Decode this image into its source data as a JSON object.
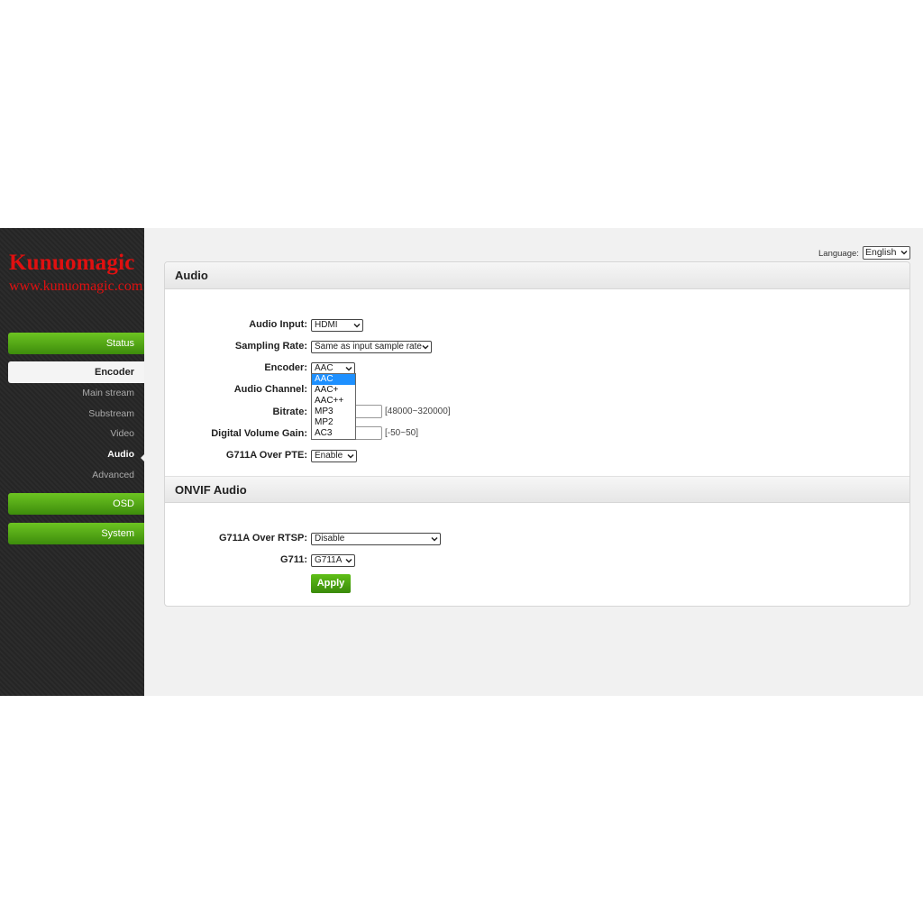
{
  "brand": {
    "name": "Kunuomagic",
    "url": "www.kunuomagic.com"
  },
  "language": {
    "label": "Language:",
    "selected": "English"
  },
  "sidebar": {
    "status": "Status",
    "encoder": "Encoder",
    "encoder_items": [
      "Main stream",
      "Substream",
      "Video",
      "Audio",
      "Advanced"
    ],
    "osd": "OSD",
    "system": "System"
  },
  "audio": {
    "title": "Audio",
    "audio_input": {
      "label": "Audio Input:",
      "value": "HDMI"
    },
    "sampling_rate": {
      "label": "Sampling Rate:",
      "value": "Same as input sample rate"
    },
    "encoder": {
      "label": "Encoder:",
      "value": "AAC",
      "options": [
        "AAC",
        "AAC+",
        "AAC++",
        "MP3",
        "MP2",
        "AC3"
      ]
    },
    "audio_channel": {
      "label": "Audio Channel:"
    },
    "bitrate": {
      "label": "Bitrate:",
      "hint": "[48000~320000]"
    },
    "volume_gain": {
      "label": "Digital Volume Gain:",
      "hint": "[-50~50]"
    },
    "g711a_pte": {
      "label": "G711A Over PTE:",
      "value": "Enable"
    }
  },
  "onvif": {
    "title": "ONVIF Audio",
    "g711a_rtsp": {
      "label": "G711A Over RTSP:",
      "value": "Disable"
    },
    "g711": {
      "label": "G711:",
      "value": "G711A"
    },
    "apply": "Apply"
  },
  "colors": {
    "nav_green": "#4fa814",
    "brand_red": "#e01010",
    "highlight_blue": "#1e90ff"
  }
}
